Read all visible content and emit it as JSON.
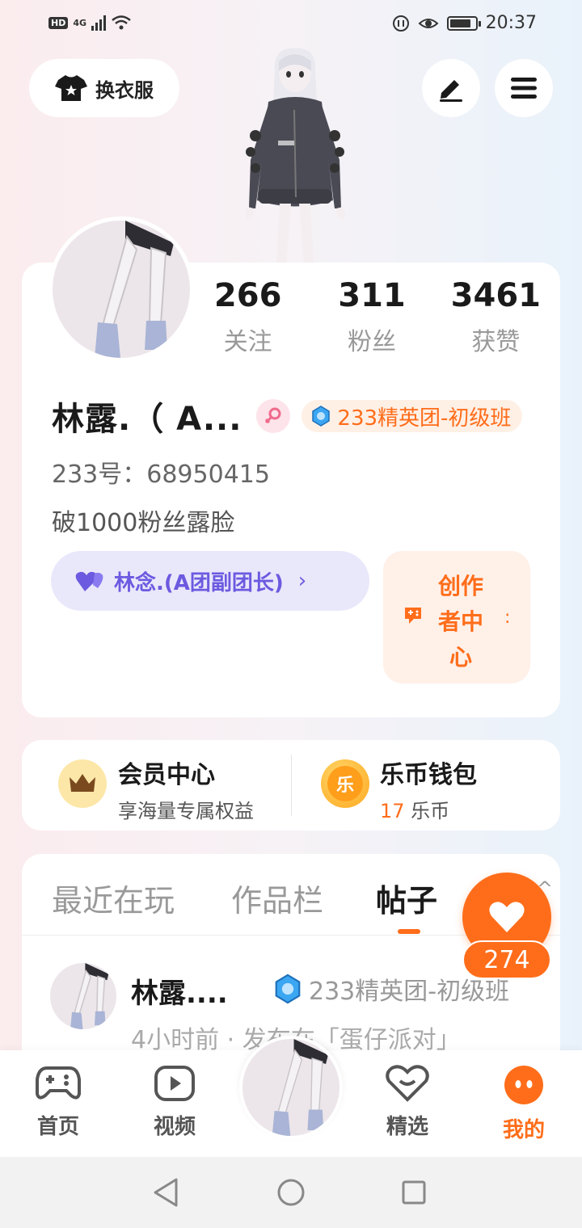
{
  "status_bar": {
    "left_label": "HD",
    "network": "4G",
    "time": "20:37"
  },
  "top_bar": {
    "outfit_label": "换衣服"
  },
  "stats": [
    {
      "value": "266",
      "label": "关注"
    },
    {
      "value": "311",
      "label": "粉丝"
    },
    {
      "value": "3461",
      "label": "获赞"
    }
  ],
  "profile": {
    "name": "林露.（ A...",
    "badge": "233精英团-初级班",
    "uid": "233号：68950415",
    "bio": "破1000粉丝露脸",
    "group_chip": "林念.(A团副团长)",
    "creator_center": "创作者中心"
  },
  "wallet": {
    "member_title": "会员中心",
    "member_sub": "享海量专属权益",
    "coin_title": "乐币钱包",
    "coin_amount": "17",
    "coin_unit": " 乐币",
    "coin_glyph": "乐"
  },
  "tabs": [
    {
      "label": "最近在玩"
    },
    {
      "label": "作品栏"
    },
    {
      "label": "帖子"
    }
  ],
  "post": {
    "author": "林露....",
    "badge": "233精英团-初级班",
    "meta": "4小时前 · 发布在「蛋仔派对」"
  },
  "like": {
    "count": "274"
  },
  "bottom_nav": [
    {
      "label": "首页"
    },
    {
      "label": "视频"
    },
    {
      "label": "精选"
    },
    {
      "label": "我的"
    }
  ],
  "colors": {
    "accent": "#ff6d1a",
    "purple": "#6c5ae0"
  }
}
